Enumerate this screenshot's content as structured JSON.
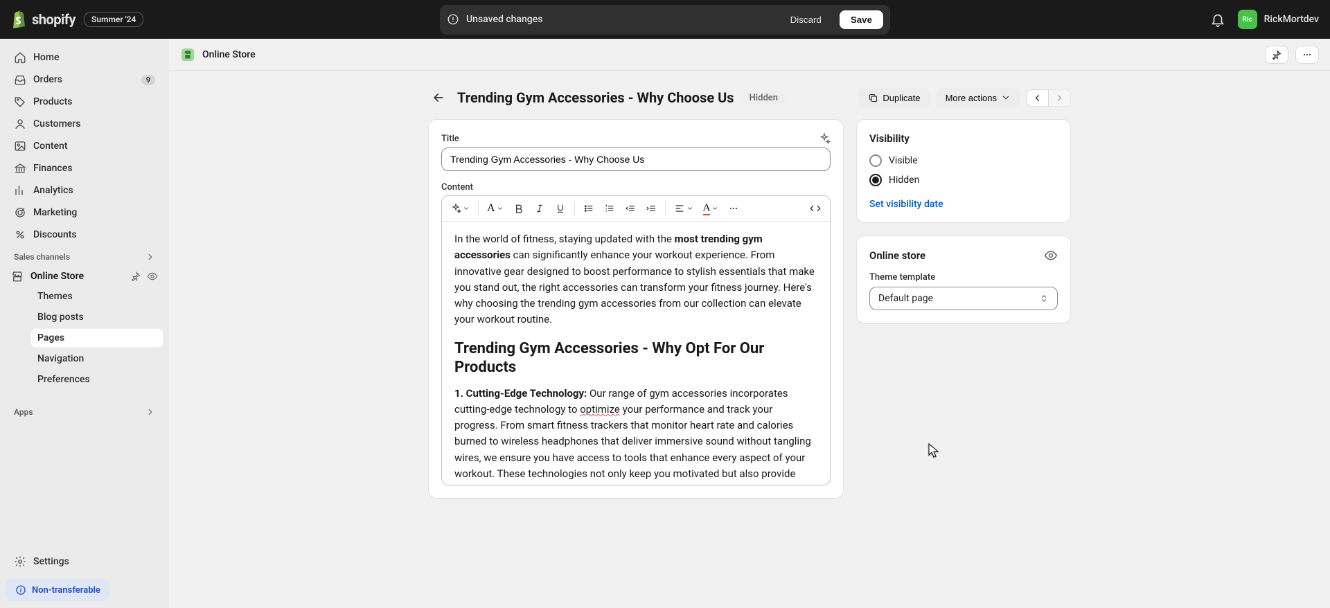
{
  "topbar": {
    "logo_text": "shopify",
    "tag": "Summer '24",
    "unsaved_label": "Unsaved changes",
    "discard_label": "Discard",
    "save_label": "Save",
    "user_initials": "Ric",
    "user_name": "RickMortdev"
  },
  "sidebar": {
    "items": [
      {
        "label": "Home",
        "icon": "home"
      },
      {
        "label": "Orders",
        "icon": "inbox",
        "badge": "9"
      },
      {
        "label": "Products",
        "icon": "tag"
      },
      {
        "label": "Customers",
        "icon": "user"
      },
      {
        "label": "Content",
        "icon": "image"
      },
      {
        "label": "Finances",
        "icon": "bank"
      },
      {
        "label": "Analytics",
        "icon": "chart"
      },
      {
        "label": "Marketing",
        "icon": "target"
      },
      {
        "label": "Discounts",
        "icon": "discount"
      }
    ],
    "sales_channels_label": "Sales channels",
    "channel": {
      "label": "Online Store"
    },
    "sub_items": [
      {
        "label": "Themes"
      },
      {
        "label": "Blog posts"
      },
      {
        "label": "Pages",
        "active": true
      },
      {
        "label": "Navigation"
      },
      {
        "label": "Preferences"
      }
    ],
    "apps_label": "Apps",
    "settings_label": "Settings",
    "non_transferable_label": "Non-transferable"
  },
  "context": {
    "breadcrumb": "Online Store"
  },
  "page": {
    "title": "Trending Gym Accessories - Why Choose Us",
    "status": "Hidden",
    "duplicate_label": "Duplicate",
    "more_actions_label": "More actions"
  },
  "editor": {
    "title_label": "Title",
    "title_value": "Trending Gym Accessories - Why Choose Us",
    "content_label": "Content",
    "para1_prefix": "In the world of fitness, staying updated with the ",
    "para1_bold": "most trending gym accessories",
    "para1_suffix": " can significantly enhance your workout experience. From innovative gear designed to boost performance to stylish essentials that make you stand out, the right accessories can transform your fitness journey. Here's why choosing the trending gym accessories from our collection can elevate your workout routine.",
    "h2": "Trending Gym Accessories - Why Opt For Our Products",
    "bullet1_label": "1. Cutting-Edge Technology:",
    "bullet1_text_a": " Our range of gym accessories incorporates cutting-edge technology to ",
    "bullet1_opt": "optimize",
    "bullet1_text_b": " your performance and track your progress. From smart fitness trackers that monitor heart rate and calories burned to wireless headphones that deliver immersive sound without tangling wires, we ensure you have access to tools that enhance every aspect of your workout. These technologies not only keep you motivated but also provide valuable insights into your fitness metrics, empowering you to achieve your goals more efficiently."
  },
  "visibility": {
    "heading": "Visibility",
    "option_visible": "Visible",
    "option_hidden": "Hidden",
    "selected": "hidden",
    "set_date_label": "Set visibility date"
  },
  "online_store": {
    "heading": "Online store",
    "template_label": "Theme template",
    "template_value": "Default page"
  }
}
